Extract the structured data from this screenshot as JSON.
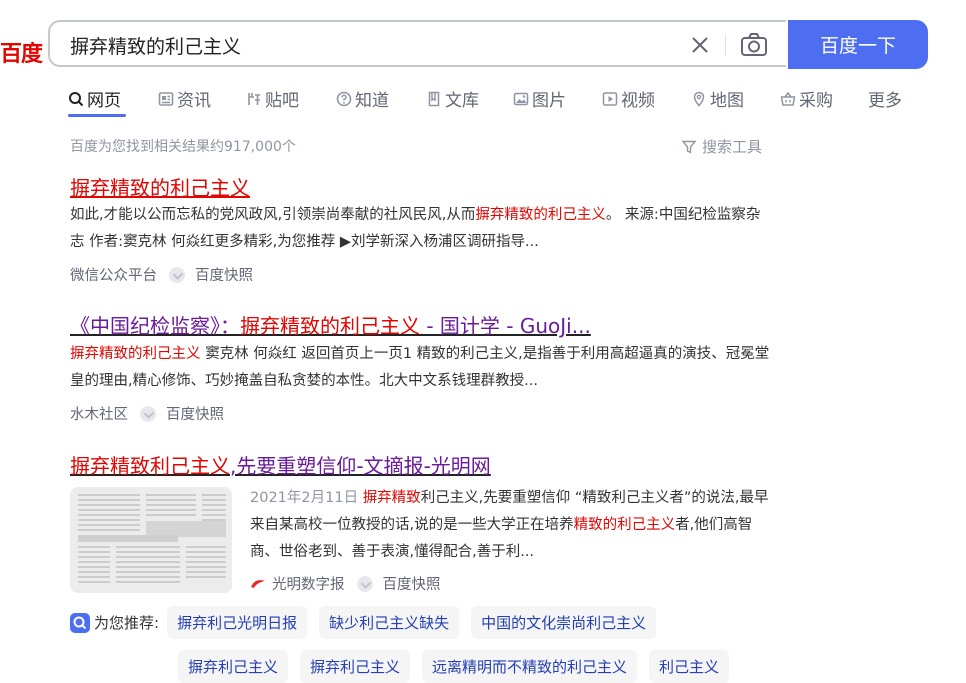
{
  "logo": {
    "text": "百度",
    "color": "#e10602"
  },
  "search": {
    "query": "摒弃精致的利己主义",
    "button_label": "百度一下",
    "accent": "#4e6ef2"
  },
  "tabs": [
    {
      "label": "网页",
      "icon": "search-icon",
      "active": true
    },
    {
      "label": "资讯",
      "icon": "news-icon"
    },
    {
      "label": "贴吧",
      "icon": "tieba-icon"
    },
    {
      "label": "知道",
      "icon": "question-icon"
    },
    {
      "label": "文库",
      "icon": "doc-icon"
    },
    {
      "label": "图片",
      "icon": "image-icon"
    },
    {
      "label": "视频",
      "icon": "video-icon"
    },
    {
      "label": "地图",
      "icon": "map-icon"
    },
    {
      "label": "采购",
      "icon": "basket-icon"
    },
    {
      "label": "更多"
    }
  ],
  "result_count": "百度为您找到相关结果约917,000个",
  "search_tools": "搜索工具",
  "results": [
    {
      "title": "摒弃精致的利己主义",
      "snippet_a": "如此,才能以公而忘私的党风政风,引领崇尚奉献的社风民风,从而",
      "snippet_hl": "摒弃精致的利己主义",
      "snippet_b": "。 来源:中国纪检监察杂志 作者:窦克林 何焱红更多精彩,为您推荐 ▶刘学新深入杨浦区调研指导...",
      "source": "微信公众平台",
      "kuaizhao": "百度快照"
    },
    {
      "title_a": "《中国纪检监察》：",
      "title_hl": "摒弃精致的利己主义",
      "title_b": " - 国计学 - GuoJi...",
      "snippet_hl": "摒弃精致的利己主义",
      "snippet_b": " 窦克林 何焱红 返回首页上一页1 精致的利己主义,是指善于利用高超逼真的演技、冠冕堂皇的理由,精心修饰、巧妙掩盖自私贪婪的本性。北大中文系钱理群教授...",
      "source": "水木社区",
      "kuaizhao": "百度快照"
    },
    {
      "title_hl": "摒弃精致利己主义",
      "title_b": ",先要重塑信仰-文摘报-光明网",
      "date": "2021年2月11日",
      "snippet_hl1": "摒弃精致",
      "snippet_a": "利己主义,先要重塑信仰 “精致利己主义者”的说法,最早来自某高校一位教授的话,说的是一些大学正在培养",
      "snippet_hl2": "精致的利己主义",
      "snippet_b": "者,他们高智商、世俗老到、善于表演,懂得配合,善于利...",
      "source": "光明数字报",
      "kuaizhao": "百度快照"
    }
  ],
  "recommend": {
    "label": "为您推荐:",
    "chips": [
      "摒弃利己光明日报",
      "缺少利己主义缺失",
      "中国的文化崇尚利己主义"
    ],
    "chips_row2": [
      "摒弃利己主义",
      "摒弃利己主义",
      "远离精明而不精致的利己主义",
      "利己主义"
    ]
  }
}
